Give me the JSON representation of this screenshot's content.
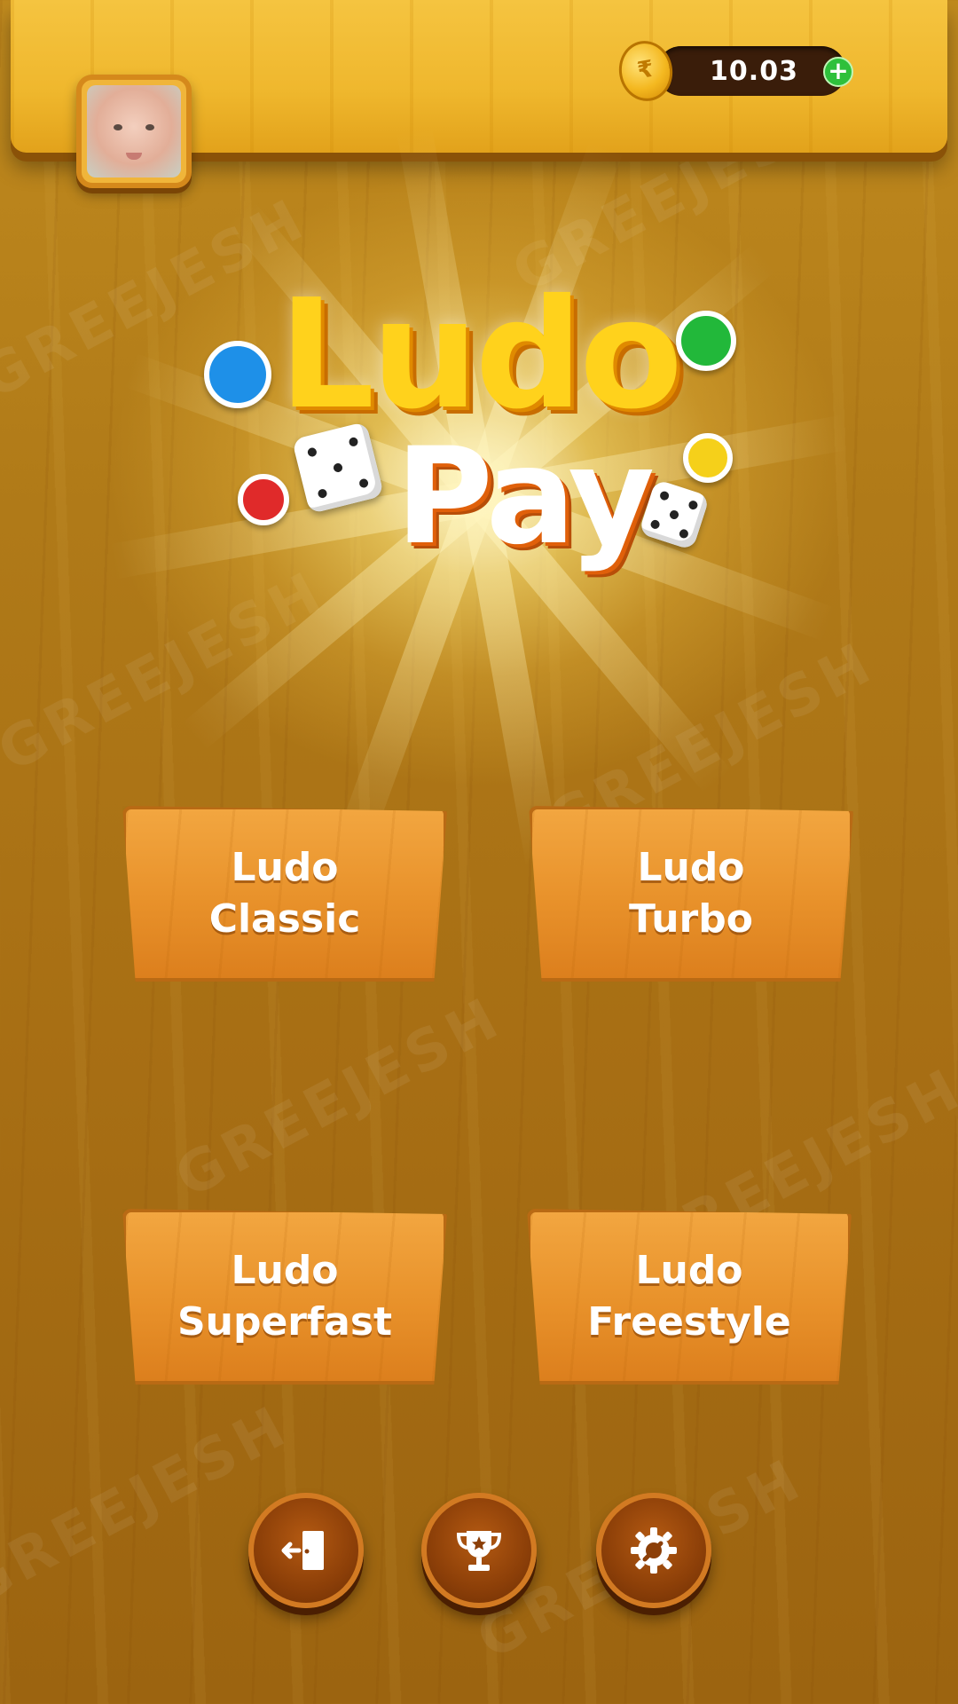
{
  "header": {
    "balance": "10.03",
    "currency_symbol": "₹",
    "add_label": "+",
    "avatar_icon": "user-avatar-icon"
  },
  "logo": {
    "line1": "Ludo",
    "line2": "Pay"
  },
  "modes": [
    {
      "line1": "Ludo",
      "line2": "Classic"
    },
    {
      "line1": "Ludo",
      "line2": "Turbo"
    },
    {
      "line1": "Ludo",
      "line2": "Superfast"
    },
    {
      "line1": "Ludo",
      "line2": "Freestyle"
    }
  ],
  "bottom_nav": [
    {
      "icon": "exit-door-icon"
    },
    {
      "icon": "trophy-icon"
    },
    {
      "icon": "settings-gear-icon"
    }
  ],
  "watermark": "GREEJESH",
  "colors": {
    "background": "#b07a18",
    "header": "#efb72d",
    "button": "#e8912a",
    "pin_blue": "#1e90e8",
    "pin_green": "#22b83a",
    "pin_red": "#e02a2a",
    "pin_yellow": "#f5d01a"
  }
}
